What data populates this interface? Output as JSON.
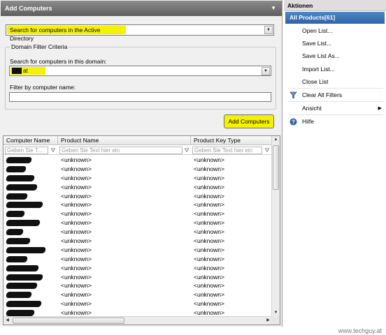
{
  "left_pane": {
    "title": "Add Computers",
    "collapse_glyph": "▼",
    "search_mode": "Search for computers in the Active Directory",
    "filter_group": {
      "legend": "Domain Filter Criteria",
      "domain_label": "Search for computers in this domain:",
      "domain_value": "at",
      "name_label": "Filter by computer name:",
      "name_value": ""
    },
    "add_button_label": "Add Computers"
  },
  "grid": {
    "columns": [
      "Computer Name",
      "Product Name",
      "Product Key Type"
    ],
    "filter_placeholders": [
      "Geben Sie T...",
      "Geben Sie Text hier ein",
      "Geben Sie Text hier ein"
    ],
    "rows": [
      {
        "product": "<unknown>",
        "key_type": "<unknown>"
      },
      {
        "product": "<unknown>",
        "key_type": "<unknown>"
      },
      {
        "product": "<unknown>",
        "key_type": "<unknown>"
      },
      {
        "product": "<unknown>",
        "key_type": "<unknown>"
      },
      {
        "product": "<unknown>",
        "key_type": "<unknown>"
      },
      {
        "product": "<unknown>",
        "key_type": "<unknown>"
      },
      {
        "product": "<unknown>",
        "key_type": "<unknown>"
      },
      {
        "product": "<unknown>",
        "key_type": "<unknown>"
      },
      {
        "product": "<unknown>",
        "key_type": "<unknown>"
      },
      {
        "product": "<unknown>",
        "key_type": "<unknown>"
      },
      {
        "product": "<unknown>",
        "key_type": "<unknown>"
      },
      {
        "product": "<unknown>",
        "key_type": "<unknown>"
      },
      {
        "product": "<unknown>",
        "key_type": "<unknown>"
      },
      {
        "product": "<unknown>",
        "key_type": "<unknown>"
      },
      {
        "product": "<unknown>",
        "key_type": "<unknown>"
      },
      {
        "product": "<unknown>",
        "key_type": "<unknown>"
      },
      {
        "product": "<unknown>",
        "key_type": "<unknown>"
      },
      {
        "product": "<unknown>",
        "key_type": "<unknown>"
      }
    ]
  },
  "actions_pane": {
    "title": "Aktionen",
    "section": "All Products[61]",
    "items": [
      {
        "label": "Open List...",
        "icon": ""
      },
      {
        "label": "Save List...",
        "icon": ""
      },
      {
        "label": "Save List As...",
        "icon": ""
      },
      {
        "label": "Import List...",
        "icon": ""
      },
      {
        "label": "Close List",
        "icon": ""
      },
      {
        "label": "Clear All Filters",
        "icon": "funnel-icon"
      },
      {
        "label": "Ansicht",
        "icon": "",
        "submenu": true
      },
      {
        "label": "Hilfe",
        "icon": "help-icon"
      }
    ]
  },
  "footer": {
    "watermark": "www.techguy.at"
  },
  "colors": {
    "highlight": "#f5f200",
    "header_gray": "#6e6e6e",
    "action_section_blue": "#3a6fb5"
  }
}
